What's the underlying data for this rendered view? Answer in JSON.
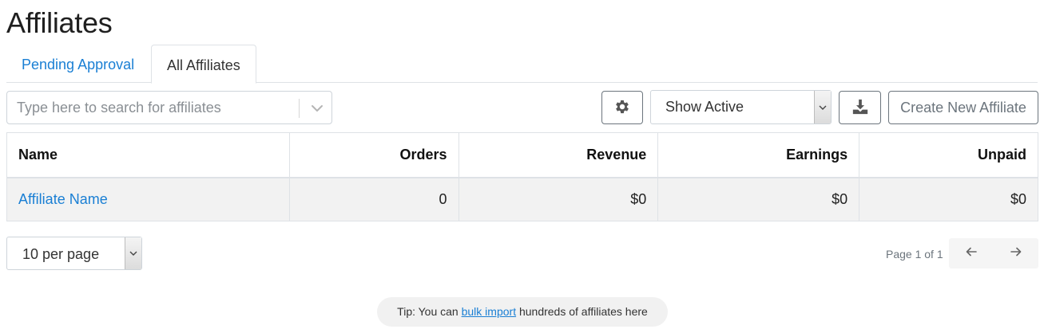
{
  "header": {
    "title": "Affiliates"
  },
  "tabs": [
    {
      "label": "Pending Approval",
      "active": false
    },
    {
      "label": "All Affiliates",
      "active": true
    }
  ],
  "toolbar": {
    "search_placeholder": "Type here to search for affiliates",
    "settings_icon": "gear-icon",
    "status_filter": "Show Active",
    "download_icon": "download-icon",
    "create_label": "Create New Affiliate"
  },
  "table": {
    "columns": [
      "Name",
      "Orders",
      "Revenue",
      "Earnings",
      "Unpaid"
    ],
    "rows": [
      {
        "name": "Affiliate Name",
        "orders": "0",
        "revenue": "$0",
        "earnings": "$0",
        "unpaid": "$0"
      }
    ]
  },
  "pagination": {
    "per_page": "10 per page",
    "page_info": "Page 1 of 1",
    "prev_icon": "arrow-left-icon",
    "next_icon": "arrow-right-icon"
  },
  "tip": {
    "prefix": "Tip: You can ",
    "link": "bulk import",
    "suffix": " hundreds of affiliates here"
  },
  "colors": {
    "link": "#1a7fd4",
    "row_bg": "#f2f2f2",
    "border": "#dee2e6"
  }
}
